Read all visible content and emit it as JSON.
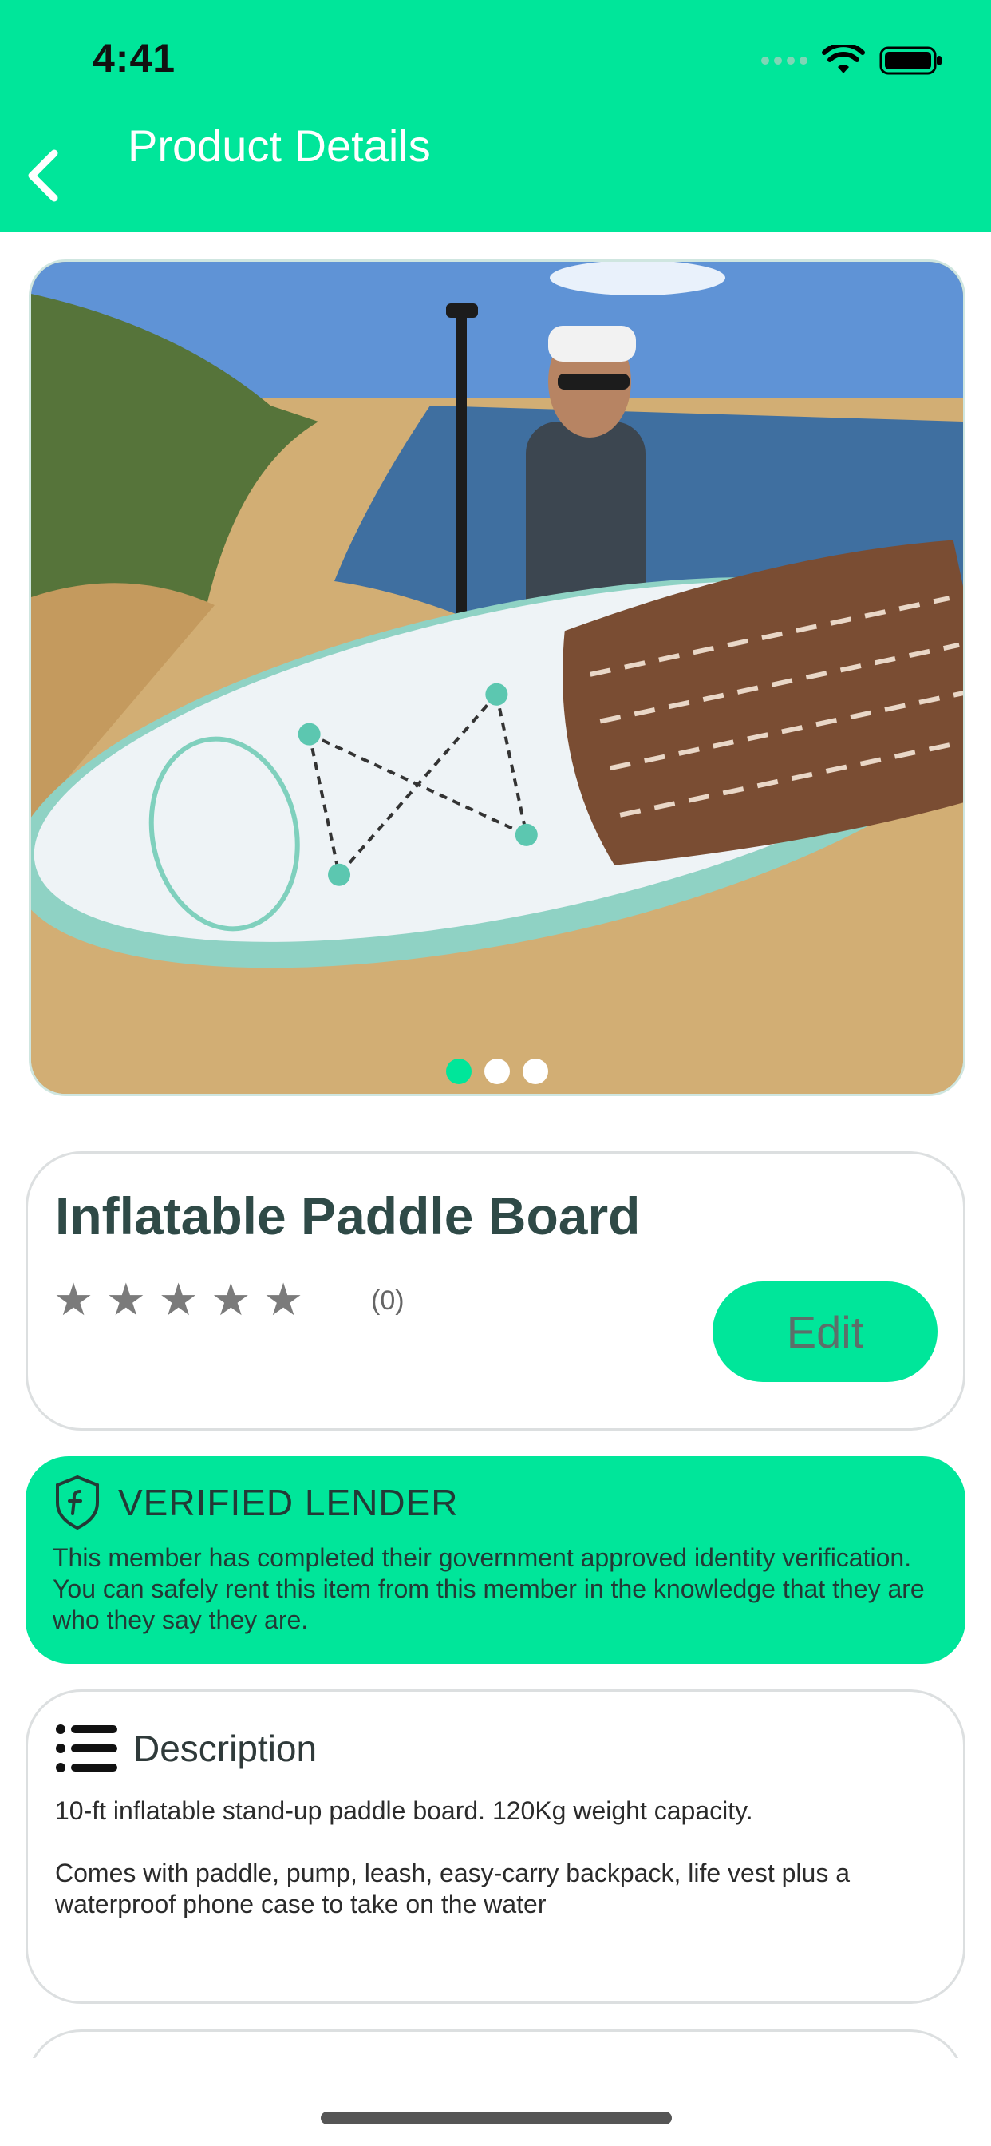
{
  "status_bar": {
    "time": "4:41"
  },
  "header": {
    "title": "Product Details",
    "back_icon": "chevron-left-icon"
  },
  "gallery": {
    "page_count": 3,
    "active_index": 0
  },
  "product": {
    "title": "Inflatable Paddle Board",
    "rating_stars": "★ ★ ★ ★ ★",
    "rating_value": 0,
    "review_count": "(0)",
    "edit_label": "Edit"
  },
  "verified": {
    "icon": "shield-icon",
    "title": "VERIFIED LENDER",
    "text": "This member has completed their government approved identity verification. You can safely rent this item from this member in the knowledge that they are who they say they are."
  },
  "description": {
    "icon": "list-icon",
    "title": "Description",
    "text": "10-ft inflatable stand-up paddle board. 120Kg weight capacity.\n\nComes with paddle, pump, leash, easy-carry backpack, life vest plus a waterproof phone case to take on the water"
  },
  "colors": {
    "accent": "#00e69a",
    "title": "#2f4a47",
    "star": "#7b7b7b"
  }
}
